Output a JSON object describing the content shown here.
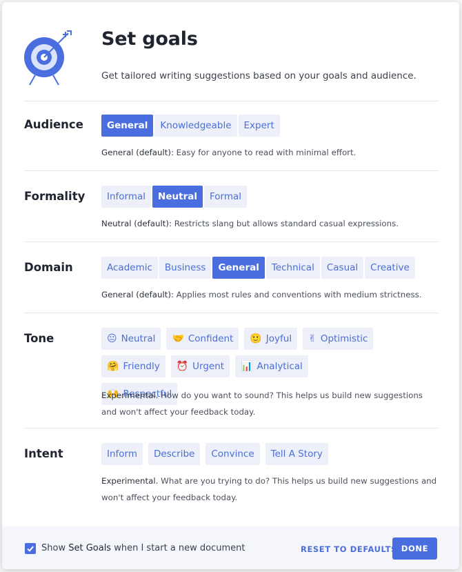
{
  "header": {
    "title": "Set goals",
    "subtitle": "Get tailored writing suggestions based on your goals and audience."
  },
  "audience": {
    "label": "Audience",
    "options": [
      "General",
      "Knowledgeable",
      "Expert"
    ],
    "selected": "General",
    "desc_prefix": "General (default):",
    "desc_text": " Easy for anyone to read with minimal effort."
  },
  "formality": {
    "label": "Formality",
    "options": [
      "Informal",
      "Neutral",
      "Formal"
    ],
    "selected": "Neutral",
    "desc_prefix": "Neutral (default):",
    "desc_text": " Restricts slang but allows standard casual expressions."
  },
  "domain": {
    "label": "Domain",
    "options": [
      "Academic",
      "Business",
      "General",
      "Technical",
      "Casual",
      "Creative"
    ],
    "selected": "General",
    "desc_prefix": "General (default):",
    "desc_text": " Applies most rules and conventions with medium strictness."
  },
  "tone": {
    "label": "Tone",
    "options": [
      {
        "emoji": "😐",
        "label": "Neutral"
      },
      {
        "emoji": "🤝",
        "label": "Confident"
      },
      {
        "emoji": "🙂",
        "label": "Joyful"
      },
      {
        "emoji": "✌",
        "label": "Optimistic"
      },
      {
        "emoji": "🤗",
        "label": "Friendly"
      },
      {
        "emoji": "⏰",
        "label": "Urgent"
      },
      {
        "emoji": "📊",
        "label": "Analytical"
      },
      {
        "emoji": "🙌",
        "label": "Respectful"
      }
    ],
    "desc_prefix": "Experimental.",
    "desc_text": " How do you want to sound? This helps us build new suggestions and won't affect your feedback today."
  },
  "intent": {
    "label": "Intent",
    "options": [
      "Inform",
      "Describe",
      "Convince",
      "Tell A Story"
    ],
    "desc_prefix": "Experimental.",
    "desc_text": " What are you trying to do? This helps us build new suggestions and won't affect your feedback today."
  },
  "footer": {
    "checkbox_checked": true,
    "text_before": "Show ",
    "text_em": "Set Goals",
    "text_after": " when I start a new document",
    "reset_label": "RESET TO DEFAULTS",
    "done_label": "DONE"
  },
  "colors": {
    "accent": "#4a6ee0",
    "chip_bg": "#edf0f8",
    "chip_text": "#4a6ed6"
  }
}
